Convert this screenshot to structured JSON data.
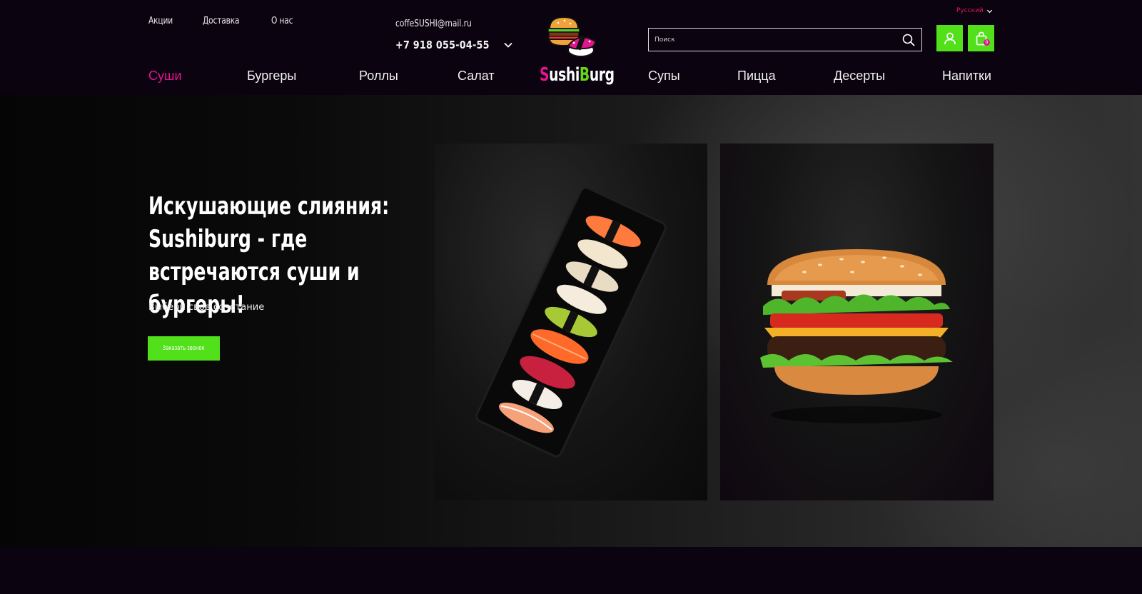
{
  "top_links": [
    "Акции",
    "Доставка",
    "О нас"
  ],
  "contact": {
    "email": "coffeSUSHI@mail.ru",
    "phone": "+7 918 055-04-55"
  },
  "logo": {
    "part1": "S",
    "part2": "ushi",
    "part3": "B",
    "part4": "urg"
  },
  "language": {
    "label": "Русский"
  },
  "search": {
    "placeholder": "Поиск"
  },
  "cart": {
    "count": "0"
  },
  "nav": [
    "Суши",
    "Бургеры",
    "Роллы",
    "Салат",
    "Супы",
    "Пицца",
    "Десерты",
    "Напитки"
  ],
  "nav_active": "Суши",
  "hero": {
    "title": "Искушающие слияния: Sushiburg - где встречаются суши и бургеры!",
    "subtitle": "Выбери свое сочетание",
    "button": "Заказать звонок"
  },
  "colors": {
    "accent_green": "#52e01a",
    "accent_pink": "#e4138f",
    "background": "#0b0310"
  },
  "icons": [
    "chevron-down-icon",
    "search-icon",
    "user-icon",
    "shopping-bag-icon"
  ]
}
